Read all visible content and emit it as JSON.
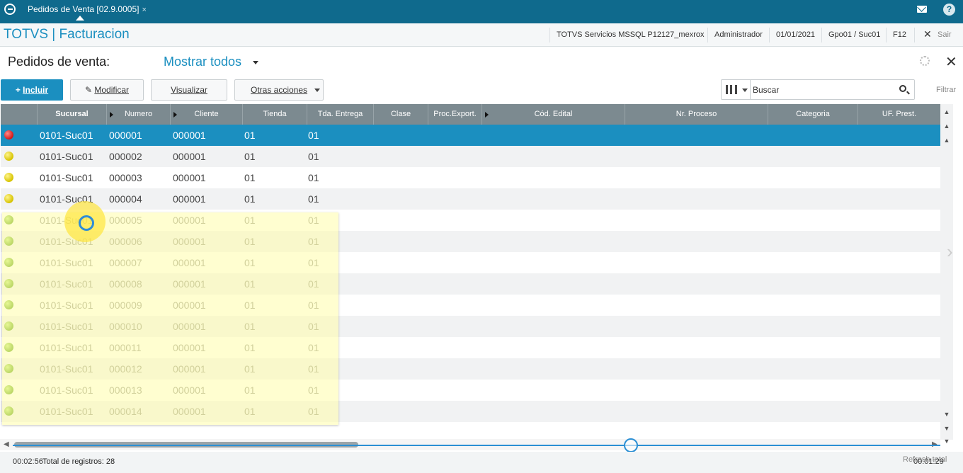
{
  "topbar": {
    "tab_title": "Pedidos de Venta [02.9.0005]",
    "tab_close": "×",
    "help": "?"
  },
  "header": {
    "brand": "TOTVS | Facturacion",
    "environment": "TOTVS Servicios MSSQL P12127_mexrox",
    "user": "Administrador",
    "date": "01/01/2021",
    "branch": "Gpo01 / Suc01",
    "shortcut": "F12",
    "exit_label": "Sair"
  },
  "page": {
    "title": "Pedidos de venta:",
    "view_filter": "Mostrar todos"
  },
  "toolbar": {
    "include_label": "Incluir",
    "modify_label": "Modificar",
    "view_label": "Visualizar",
    "other_actions_label": "Otras acciones",
    "search_value": "Buscar",
    "filter_label": "Filtrar"
  },
  "grid": {
    "columns": [
      "Sucursal",
      "Numero",
      "Cliente",
      "Tienda",
      "Tda. Entrega",
      "Clase",
      "Proc.Export.",
      "Cód. Edital",
      "Nr. Proceso",
      "Categoria",
      "UF. Prest."
    ],
    "rows": [
      {
        "status": "red",
        "sucursal": "0101-Suc01",
        "numero": "000001",
        "cliente": "000001",
        "tienda": "01",
        "tda_entrega": "01"
      },
      {
        "status": "yellow",
        "sucursal": "0101-Suc01",
        "numero": "000002",
        "cliente": "000001",
        "tienda": "01",
        "tda_entrega": "01"
      },
      {
        "status": "yellow",
        "sucursal": "0101-Suc01",
        "numero": "000003",
        "cliente": "000001",
        "tienda": "01",
        "tda_entrega": "01"
      },
      {
        "status": "yellow",
        "sucursal": "0101-Suc01",
        "numero": "000004",
        "cliente": "000001",
        "tienda": "01",
        "tda_entrega": "01"
      },
      {
        "status": "green",
        "sucursal": "0101-Suc01",
        "numero": "000005",
        "cliente": "000001",
        "tienda": "01",
        "tda_entrega": "01"
      },
      {
        "status": "green",
        "sucursal": "0101-Suc01",
        "numero": "000006",
        "cliente": "000001",
        "tienda": "01",
        "tda_entrega": "01"
      },
      {
        "status": "green",
        "sucursal": "0101-Suc01",
        "numero": "000007",
        "cliente": "000001",
        "tienda": "01",
        "tda_entrega": "01"
      },
      {
        "status": "green",
        "sucursal": "0101-Suc01",
        "numero": "000008",
        "cliente": "000001",
        "tienda": "01",
        "tda_entrega": "01"
      },
      {
        "status": "green",
        "sucursal": "0101-Suc01",
        "numero": "000009",
        "cliente": "000001",
        "tienda": "01",
        "tda_entrega": "01"
      },
      {
        "status": "green",
        "sucursal": "0101-Suc01",
        "numero": "000010",
        "cliente": "000001",
        "tienda": "01",
        "tda_entrega": "01"
      },
      {
        "status": "green",
        "sucursal": "0101-Suc01",
        "numero": "000011",
        "cliente": "000001",
        "tienda": "01",
        "tda_entrega": "01"
      },
      {
        "status": "green",
        "sucursal": "0101-Suc01",
        "numero": "000012",
        "cliente": "000001",
        "tienda": "01",
        "tda_entrega": "01"
      },
      {
        "status": "green",
        "sucursal": "0101-Suc01",
        "numero": "000013",
        "cliente": "000001",
        "tienda": "01",
        "tda_entrega": "01"
      },
      {
        "status": "green",
        "sucursal": "0101-Suc01",
        "numero": "000014",
        "cliente": "000001",
        "tienda": "01",
        "tda_entrega": "01"
      }
    ],
    "selected_row": 0
  },
  "footer": {
    "video_time_elapsed": "00:02:56",
    "total_records": "Total de registros: 28",
    "refresh_label": "Refresh total",
    "video_time_remaining": "00:01:29"
  },
  "colors": {
    "brand": "#1b8fc0",
    "topbar": "#0f6a8d",
    "grid_header": "#7c8a90"
  },
  "icons": [
    "app-logo-icon",
    "mail-icon",
    "help-icon",
    "gear-icon",
    "close-icon",
    "plus-icon",
    "pencil-icon",
    "columns-icon",
    "search-icon"
  ]
}
